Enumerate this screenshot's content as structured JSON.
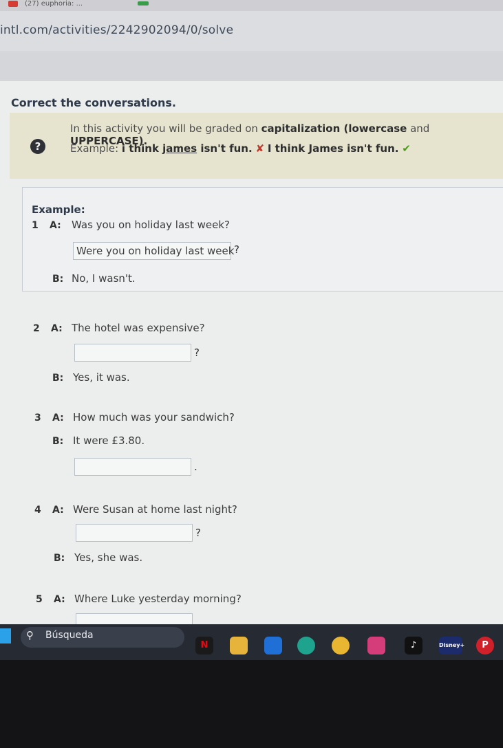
{
  "browser": {
    "tab_title": "(27) euphoria: ...",
    "url": "intl.com/activities/2242902094/0/solve"
  },
  "activity": {
    "instructions": "Correct the conversations.",
    "note": {
      "line1_pre": "In this activity you will be graded on ",
      "line1_bold1": "capitalization (lowercase",
      "line1_mid": " and ",
      "line1_bold2": "UPPERCASE).",
      "example_label": "Example: ",
      "wrong_pre": "i think ",
      "wrong_underlined": "james",
      "wrong_post": " isn't fun.",
      "cross": "✘",
      "right": "I think James isn't fun.",
      "check": "✔"
    },
    "example_heading": "Example:",
    "items": [
      {
        "num": "1",
        "a_label": "A:",
        "a_text": "Was you on holiday last week?",
        "answer": "Were you on holiday last week",
        "answer_punct": "?",
        "b_label": "B:",
        "b_text": "No, I wasn't."
      },
      {
        "num": "2",
        "a_label": "A:",
        "a_text": "The hotel was expensive?",
        "answer": "",
        "answer_punct": "?",
        "b_label": "B:",
        "b_text": "Yes, it was."
      },
      {
        "num": "3",
        "a_label": "A:",
        "a_text": "How much was your sandwich?",
        "b_label": "B:",
        "b_text": "It were £3.80.",
        "answer": "",
        "answer_punct": "."
      },
      {
        "num": "4",
        "a_label": "A:",
        "a_text": "Were Susan at home last night?",
        "answer": "",
        "answer_punct": "?",
        "b_label": "B:",
        "b_text": "Yes, she was."
      },
      {
        "num": "5",
        "a_label": "A:",
        "a_text": "Where Luke yesterday morning?"
      }
    ]
  },
  "taskbar": {
    "search_label": "Búsqueda",
    "icons": [
      "netflix-icon",
      "folder-icon",
      "store-icon",
      "edge-icon",
      "chrome-icon",
      "instagram-icon",
      "tiktok-icon",
      "disney-icon",
      "pinterest-icon"
    ],
    "netflix_letter": "N",
    "disney_label": "Disney+",
    "pinterest_letter": "P"
  },
  "colors": {
    "note_bg": "#e6e4cf",
    "accent_text": "#2f3b4b",
    "cross": "#c0392b",
    "check": "#4f9a1f",
    "taskbar": "#252a33"
  }
}
